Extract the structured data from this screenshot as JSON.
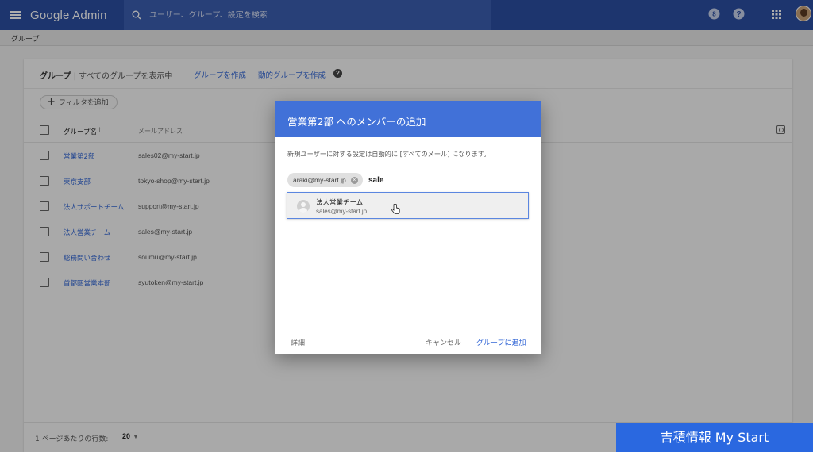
{
  "app": {
    "title": "Google Admin"
  },
  "search": {
    "placeholder": "ユーザー、グループ、設定を検索"
  },
  "topbar": {
    "notification_count": "8",
    "help": "?"
  },
  "breadcrumb": "グループ",
  "groups_page": {
    "title": "グループ",
    "subtitle": " | すべてのグループを表示中",
    "create_group": "グループを作成",
    "create_dynamic_group": "動的グループを作成",
    "add_filter": "フィルタを追加",
    "columns": {
      "name": "グループ名",
      "email": "メールアドレス"
    },
    "rows": [
      {
        "name": "営業第2部",
        "email": "sales02@my-start.jp"
      },
      {
        "name": "東京支部",
        "email": "tokyo-shop@my-start.jp"
      },
      {
        "name": "法人サポートチーム",
        "email": "support@my-start.jp"
      },
      {
        "name": "法人営業チーム",
        "email": "sales@my-start.jp"
      },
      {
        "name": "総務問い合わせ",
        "email": "soumu@my-start.jp"
      },
      {
        "name": "首都圏営業本部",
        "email": "syutoken@my-start.jp"
      }
    ],
    "footer": {
      "rows_per_page_label": "1 ページあたりの行数:",
      "rows_per_page_value": "20"
    }
  },
  "dialog": {
    "title": "営業第2部 へのメンバーの追加",
    "description": "新規ユーザーに対する設定は自動的に [すべてのメール] になります。",
    "chip": "araki@my-start.jp",
    "input_value": "sale",
    "suggestion": {
      "name": "法人営業チーム",
      "email": "sales@my-start.jp"
    },
    "details": "詳細",
    "cancel": "キャンセル",
    "add": "グループに追加"
  },
  "watermark": "吉積情報 My Start",
  "colors": {
    "appbar": "#2b4ea3",
    "dialog_header": "#4171d8",
    "link": "#3367d6",
    "watermark": "#2a68e0"
  }
}
